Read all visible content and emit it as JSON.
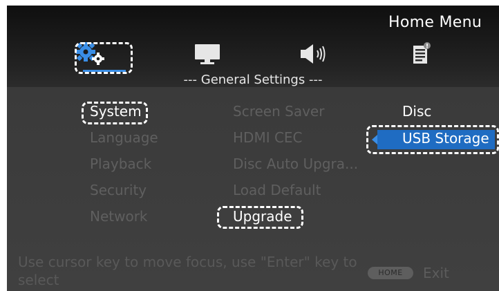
{
  "header": {
    "title": "Home Menu",
    "section_title": "--- General Settings ---"
  },
  "tabs": [
    {
      "name": "settings",
      "icon": "gear-icon",
      "active": true
    },
    {
      "name": "display",
      "icon": "monitor-icon",
      "active": false
    },
    {
      "name": "audio",
      "icon": "speaker-icon",
      "active": false
    },
    {
      "name": "info",
      "icon": "document-info-icon",
      "active": false
    }
  ],
  "menu": {
    "column1": [
      "System",
      "Language",
      "Playback",
      "Security",
      "Network"
    ],
    "column2": [
      "Screen Saver",
      "HDMI CEC",
      "Disc Auto Upgra...",
      "Load Default",
      "Upgrade"
    ],
    "column3": [
      "Disc",
      "USB Storage"
    ]
  },
  "selection": {
    "column1": "System",
    "column2": "Upgrade",
    "column3": "USB Storage"
  },
  "footer": {
    "hint": "Use cursor key to move focus, use \"Enter\" key to select",
    "home_button": "HOME",
    "exit_label": "Exit"
  },
  "colors": {
    "accent": "#3a8ee6",
    "selection_bg": "#1f6cc2",
    "text_active": "#ffffff",
    "text_dim": "#5f5f5f"
  }
}
